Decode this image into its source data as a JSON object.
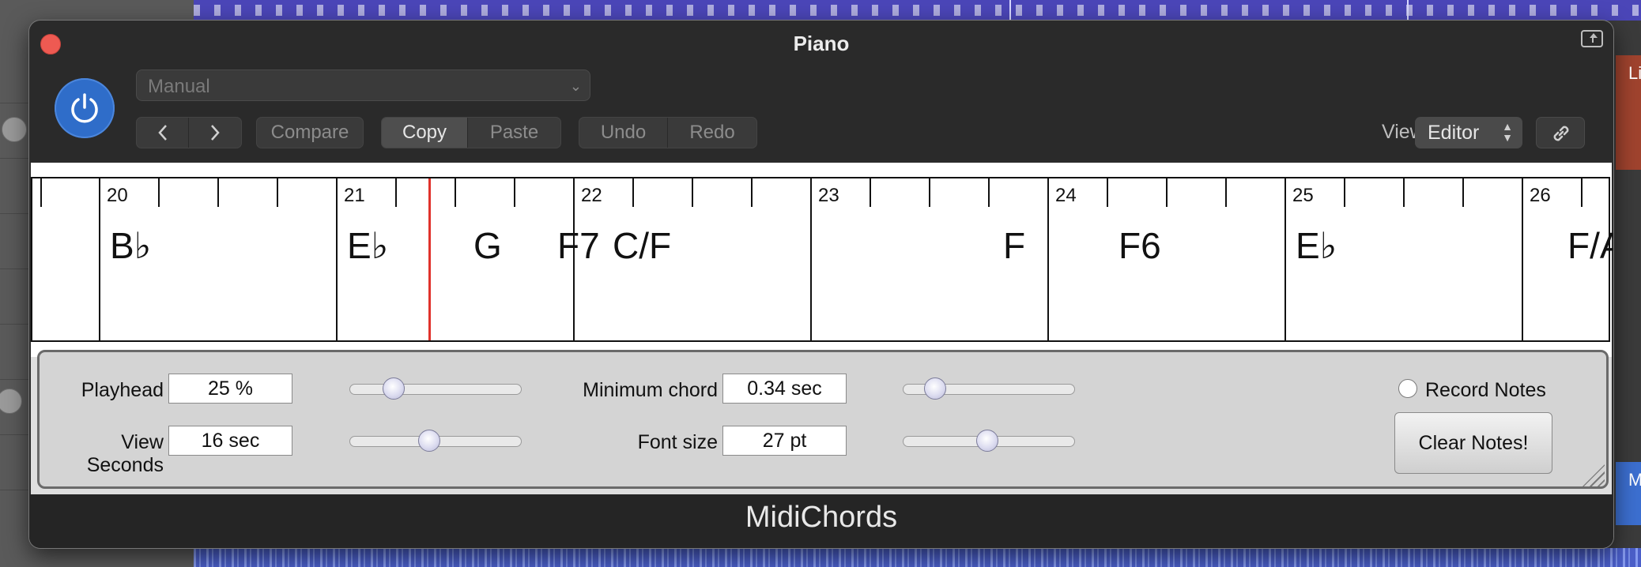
{
  "window": {
    "title": "Piano",
    "footer_title": "MidiChords"
  },
  "header": {
    "preset_value": "Manual",
    "nav_prev_icon": "chevron-left-icon",
    "nav_next_icon": "chevron-right-icon",
    "compare_label": "Compare",
    "copy_label": "Copy",
    "paste_label": "Paste",
    "undo_label": "Undo",
    "redo_label": "Redo",
    "view_label": "View:",
    "view_value": "Editor"
  },
  "timeline": {
    "bars": [
      "20",
      "21",
      "22",
      "23",
      "24",
      "25",
      "26"
    ],
    "chords": [
      "B♭",
      "E♭",
      "G",
      "F7",
      "C/F",
      "F",
      "F6",
      "E♭",
      "F/A"
    ]
  },
  "controls": {
    "playhead": {
      "label": "Playhead",
      "value": "25 %"
    },
    "view_seconds": {
      "label": "View Seconds",
      "value": "16 sec"
    },
    "minimum_chord": {
      "label": "Minimum chord",
      "value": "0.34 sec"
    },
    "font_size": {
      "label": "Font size",
      "value": "27 pt"
    },
    "record_notes_label": "Record Notes",
    "clear_notes_label": "Clear Notes!"
  },
  "colors": {
    "power_blue": "#2f6dc9",
    "playhead_red": "#e0322b",
    "close_red": "#ee5a52"
  }
}
